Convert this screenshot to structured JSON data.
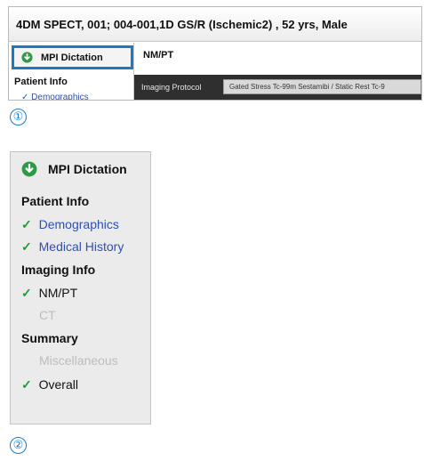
{
  "panel1": {
    "patient_header": "4DM SPECT, 001; 004-001,1D GS/R (Ischemic2) , 52 yrs, Male",
    "tab_label": "MPI Dictation",
    "left_section": "Patient Info",
    "left_cut_text": "✓ Demographics",
    "right_title": "NM/PT",
    "protocol_label": "Imaging Protocol",
    "protocol_value": "Gated Stress Tc-99m Sestamibi / Static Rest Tc-9"
  },
  "badges": [
    "①",
    "②"
  ],
  "sidebar": {
    "header": "MPI Dictation",
    "sections": {
      "patient_info": "Patient Info",
      "imaging_info": "Imaging Info",
      "summary": "Summary"
    },
    "items": {
      "demographics": "Demographics",
      "medical_history": "Medical History",
      "nm_pt": "NM/PT",
      "ct": "CT",
      "miscellaneous": "Miscellaneous",
      "overall": "Overall"
    },
    "check": "✓"
  },
  "colors": {
    "accent": "#1a7bc4",
    "check": "#1f9a3a",
    "link": "#2e4fb8",
    "disabled": "#bdbdbd"
  },
  "icons": {
    "download": "download-arrow-icon"
  }
}
